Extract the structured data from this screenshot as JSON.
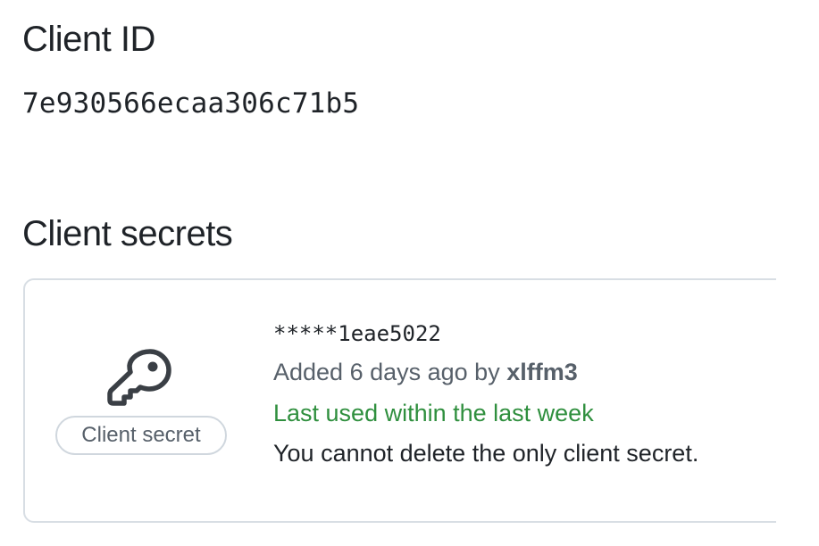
{
  "client_id": {
    "heading": "Client ID",
    "value": "7e930566ecaa306c71b5"
  },
  "client_secrets": {
    "heading": "Client secrets",
    "items": [
      {
        "icon": "key-icon",
        "badge": "Client secret",
        "masked_value": "*****1eae5022",
        "added_prefix": "Added 6 days ago by ",
        "added_by": "xlffm3",
        "last_used": "Last used within the last week",
        "note": "You cannot delete the only client secret."
      }
    ]
  },
  "colors": {
    "text": "#1f2328",
    "muted": "#57606a",
    "success": "#2f8f3e",
    "border": "#d8dee4"
  }
}
